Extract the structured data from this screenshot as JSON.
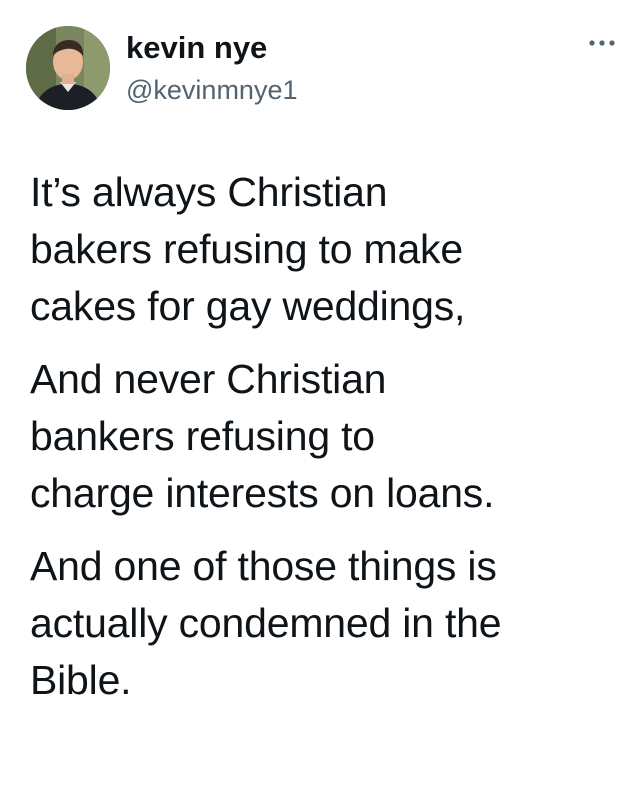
{
  "author": {
    "display_name": "kevin nye",
    "handle": "@kevinmnye1",
    "avatar_icon": "user-avatar-photo"
  },
  "menu": {
    "icon": "more-dots-icon"
  },
  "tweet": {
    "paragraphs": [
      "It’s always Christian\nbakers refusing to make\ncakes for gay weddings,",
      "And never Christian\nbankers refusing to\ncharge interests on loans.",
      "And one of those things is\nactually condemned in the\nBible."
    ]
  },
  "colors": {
    "text_primary": "#0f1419",
    "text_secondary": "#536471",
    "background": "#ffffff"
  }
}
